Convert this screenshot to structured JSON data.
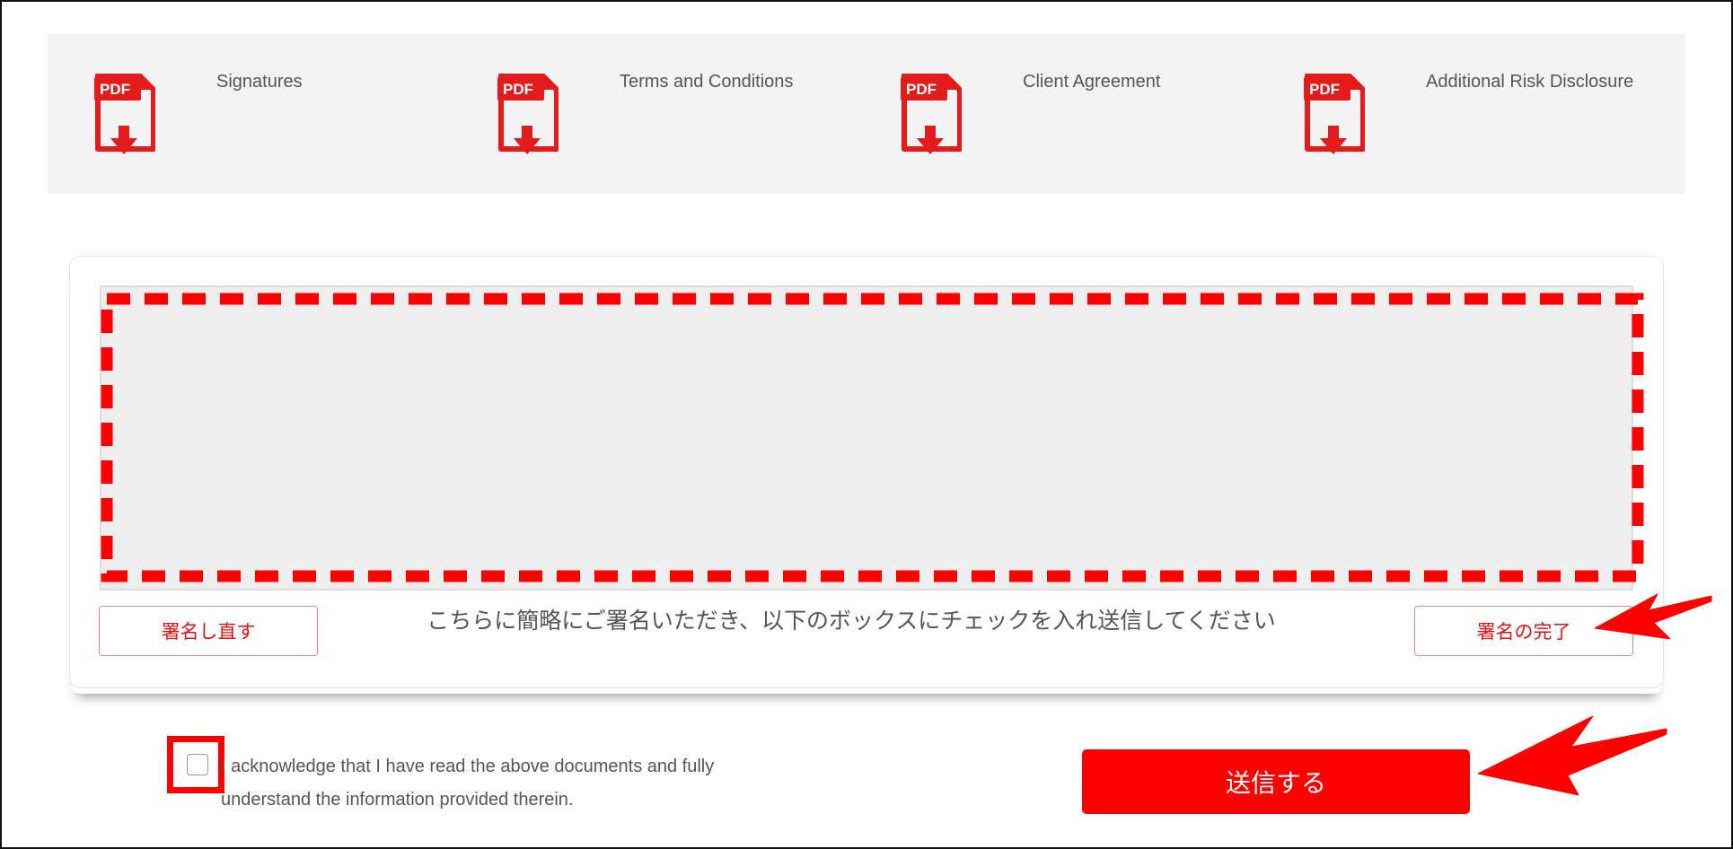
{
  "documents": [
    {
      "title": "Signatures",
      "icon": "pdf-download-icon",
      "icon_text": "PDF"
    },
    {
      "title": "Terms and Conditions",
      "icon": "pdf-download-icon",
      "icon_text": "PDF"
    },
    {
      "title": "Client Agreement",
      "icon": "pdf-download-icon",
      "icon_text": "PDF"
    },
    {
      "title": "Additional Risk Disclosure",
      "icon": "pdf-download-icon",
      "icon_text": "PDF"
    }
  ],
  "signature": {
    "clear_label": "署名し直す",
    "instruction": "こちらに簡略にご署名いただき、以下のボックスにチェックを入れ送信してください",
    "complete_label": "署名の完了"
  },
  "acknowledgement": {
    "text": "I acknowledge that I have read the above documents and fully understand the information provided therein.",
    "checked": false
  },
  "submit": {
    "label": "送信する"
  },
  "colors": {
    "accent": "#ff0000",
    "bar_bg": "#f3f3f3",
    "canvas_bg": "#eeeeee",
    "text": "#555555"
  }
}
